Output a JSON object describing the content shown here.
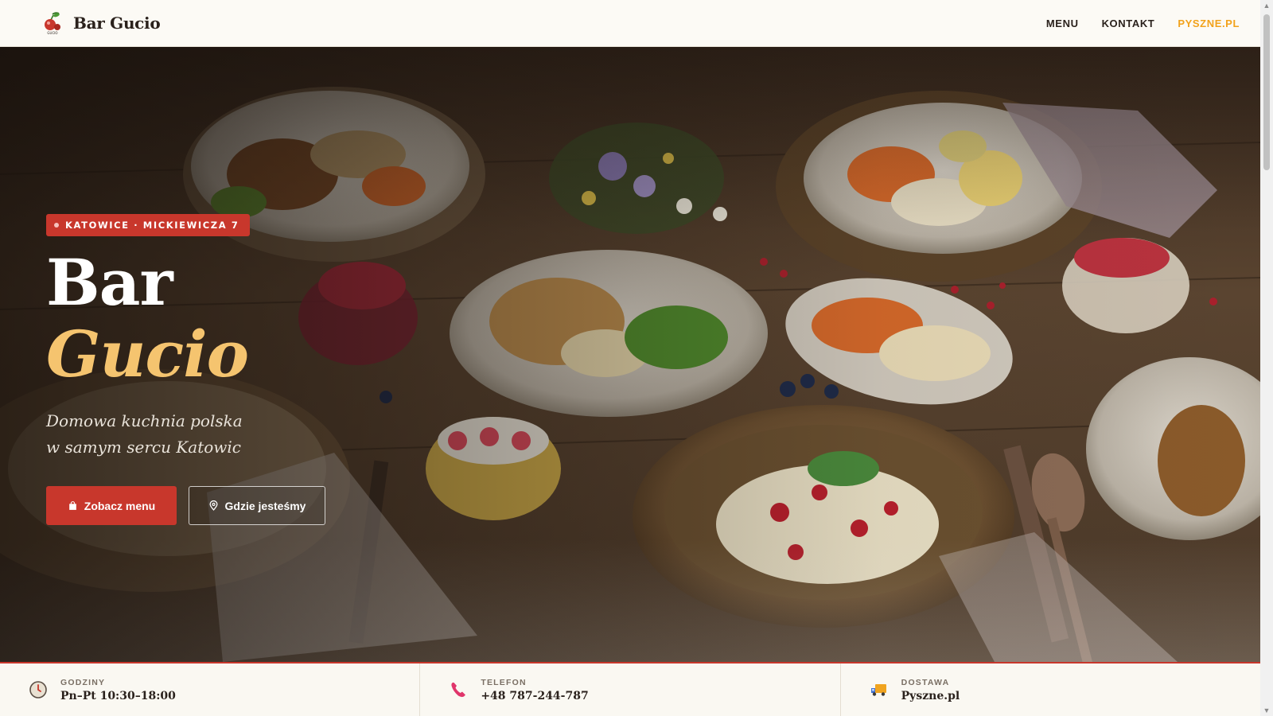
{
  "header": {
    "brand_name": "Bar Gucio",
    "logo_text": "GUCIO",
    "nav": [
      {
        "label": "MENU"
      },
      {
        "label": "KONTAKT"
      },
      {
        "label": "PYSZNE.PL"
      }
    ]
  },
  "hero": {
    "badge": "KATOWICE · MICKIEWICZA 7",
    "title_line1": "Bar",
    "title_line2": "Gucio",
    "subtitle_line1": "Domowa kuchnia polska",
    "subtitle_line2": "w samym sercu Katowic",
    "primary_button": "Zobacz menu",
    "secondary_button": "Gdzie jesteśmy"
  },
  "info": [
    {
      "label": "GODZINY",
      "value": "Pn–Pt 10:30–18:00",
      "icon": "clock-icon"
    },
    {
      "label": "TELEFON",
      "value": "+48 787-244-787",
      "icon": "phone-icon"
    },
    {
      "label": "DOSTAWA",
      "value": "Pyszne.pl",
      "icon": "delivery-truck-icon"
    }
  ],
  "colors": {
    "accent_red": "#c8372c",
    "accent_gold": "#f5c46f",
    "nav_accent": "#f2a21b",
    "dark_text": "#2a211c"
  }
}
